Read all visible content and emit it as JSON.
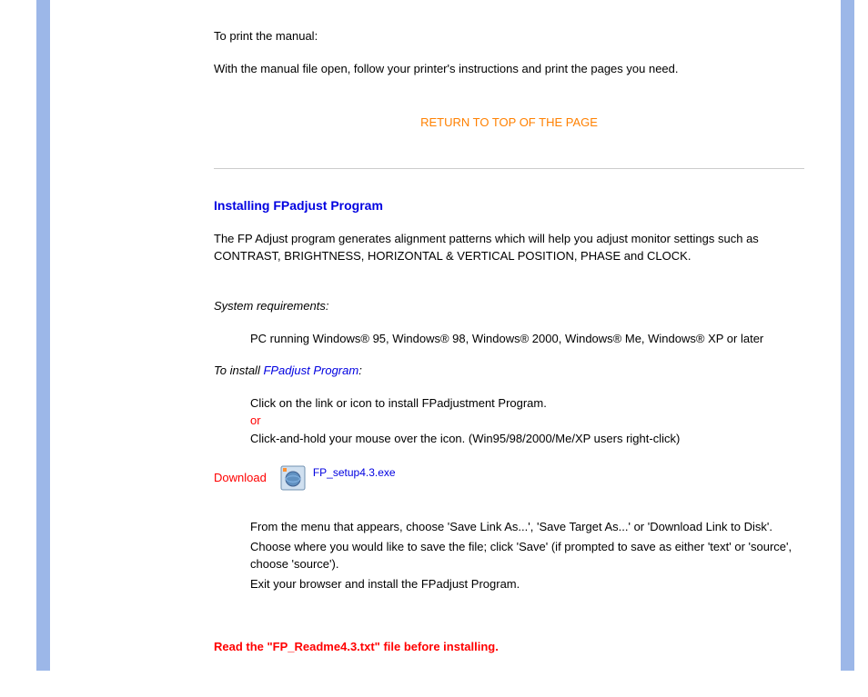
{
  "intro": {
    "line1": "To print the manual:",
    "line2": "With the manual file open, follow your printer's instructions and print the pages you need."
  },
  "return_link": "RETURN TO TOP OF THE PAGE",
  "section": {
    "title": "Installing FPadjust Program",
    "desc": "The FP Adjust program generates alignment patterns which will help you adjust monitor settings such as CONTRAST, BRIGHTNESS, HORIZONTAL & VERTICAL POSITION, PHASE and CLOCK.",
    "sysreq_label": "System requirements:",
    "sysreq_item": "PC running Windows® 95, Windows® 98, Windows® 2000, Windows® Me, Windows® XP or later",
    "install_prefix": "To install ",
    "install_link": "FPadjust Program",
    "install_suffix": ":",
    "inst1": "Click on the link or icon to install FPadjustment Program.",
    "or": "or",
    "inst2": "Click-and-hold your mouse over the icon. (Win95/98/2000/Me/XP users right-click)"
  },
  "download": {
    "label": "Download",
    "filename": "FP_setup4.3.exe"
  },
  "steps": {
    "s1": "From the menu that appears, choose 'Save Link As...', 'Save Target As...' or 'Download Link to Disk'.",
    "s2": "Choose where you would like to save the file; click 'Save' (if prompted to save as either 'text' or 'source', choose 'source').",
    "s3": "Exit your browser and install the FPadjust Program."
  },
  "warning": "Read the \"FP_Readme4.3.txt\" file before installing."
}
